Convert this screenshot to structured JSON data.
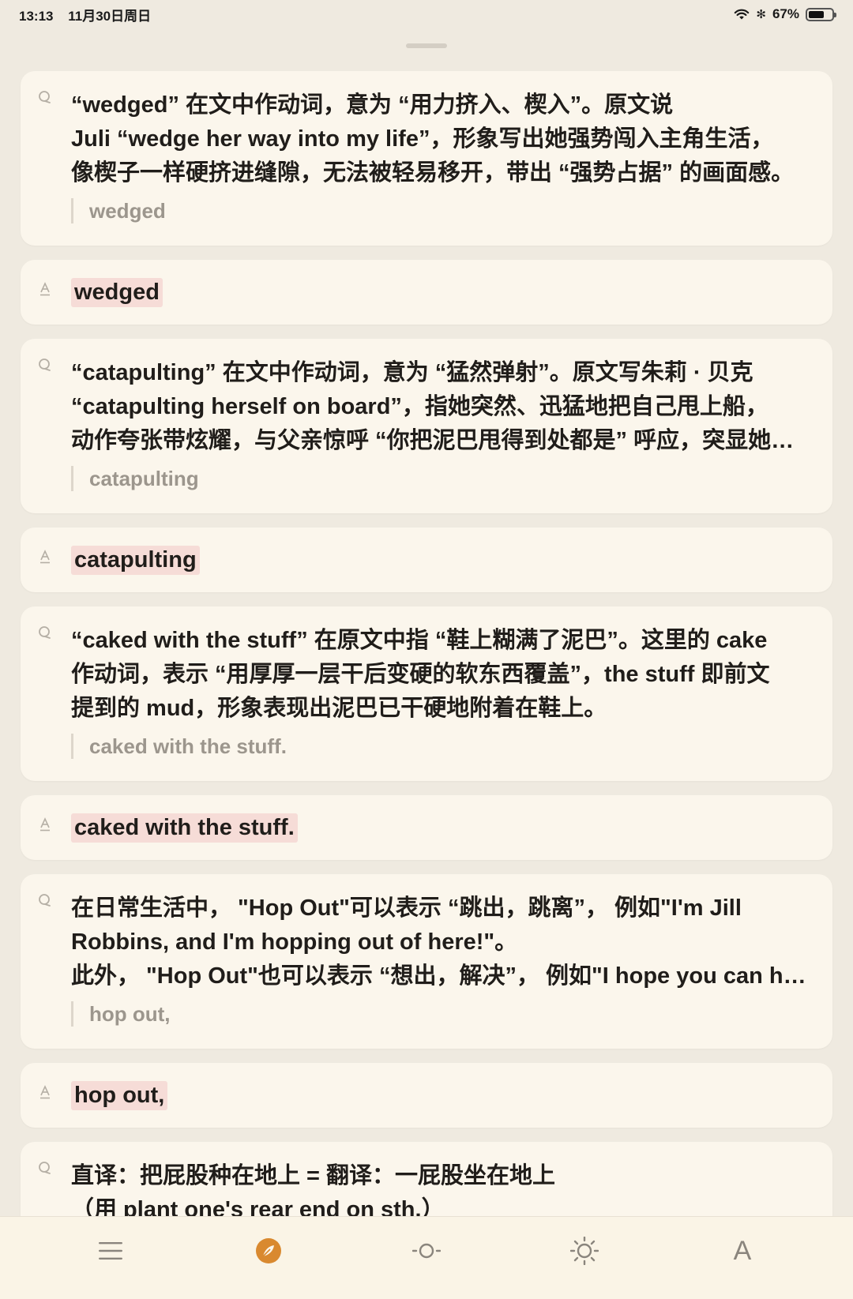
{
  "status_bar": {
    "time": "13:13",
    "date": "11月30日周日",
    "battery": "67%",
    "battery_level": 0.67
  },
  "cards": [
    {
      "type": "note",
      "text": "“wedged” 在文中作动词，意为 “用力挤入、楔入”。原文说\nJuli “wedge her way into my life”，形象写出她强势闯入主角生活，\n像楔子一样硬挤进缝隙，无法被轻易移开，带出 “强势占据” 的画面感。",
      "quote": "wedged",
      "clamp": false
    },
    {
      "type": "highlight",
      "text": "wedged"
    },
    {
      "type": "note",
      "text": "“catapulting” 在文中作动词，意为 “猛然弹射”。原文写朱莉 · 贝克\n“catapulting herself on board”，指她突然、迅猛地把自己甩上船，\n动作夸张带炫耀，与父亲惊呼 “你把泥巴甩得到处都是” 呼应，突显她活泼冲动的性格。",
      "quote": "catapulting",
      "clamp": true
    },
    {
      "type": "highlight",
      "text": "catapulting"
    },
    {
      "type": "note",
      "text": "“caked with the stuff” 在原文中指 “鞋上糊满了泥巴”。这里的 cake\n作动词，表示 “用厚厚一层干后变硬的软东西覆盖”，the stuff 即前文\n提到的 mud，形象表现出泥巴已干硬地附着在鞋上。",
      "quote": "caked with the stuff.",
      "clamp": false
    },
    {
      "type": "highlight",
      "text": "caked with the stuff."
    },
    {
      "type": "note",
      "text": "在日常生活中， \"Hop Out\"可以表示 “跳出，跳离”， 例如\"I'm Jill\nRobbins, and I'm hopping out of here!\"。\n此外， \"Hop Out\"也可以表示 “想出，解决”， 例如\"I hope you can hop out a solution.\"",
      "quote": "hop out,",
      "clamp": true
    },
    {
      "type": "highlight",
      "text": "hop out,"
    },
    {
      "type": "note",
      "text": "直译：把屁股种在地上 = 翻译：一屁股坐在地上\n（用 plant one's rear end on sth.）",
      "quote": "",
      "clamp": false
    }
  ],
  "toolbar": {
    "items": [
      "list-icon",
      "compass-icon",
      "brightness-low-icon",
      "brightness-high-icon",
      "font-icon"
    ],
    "font_label": "A",
    "accent": "#d9892f"
  }
}
